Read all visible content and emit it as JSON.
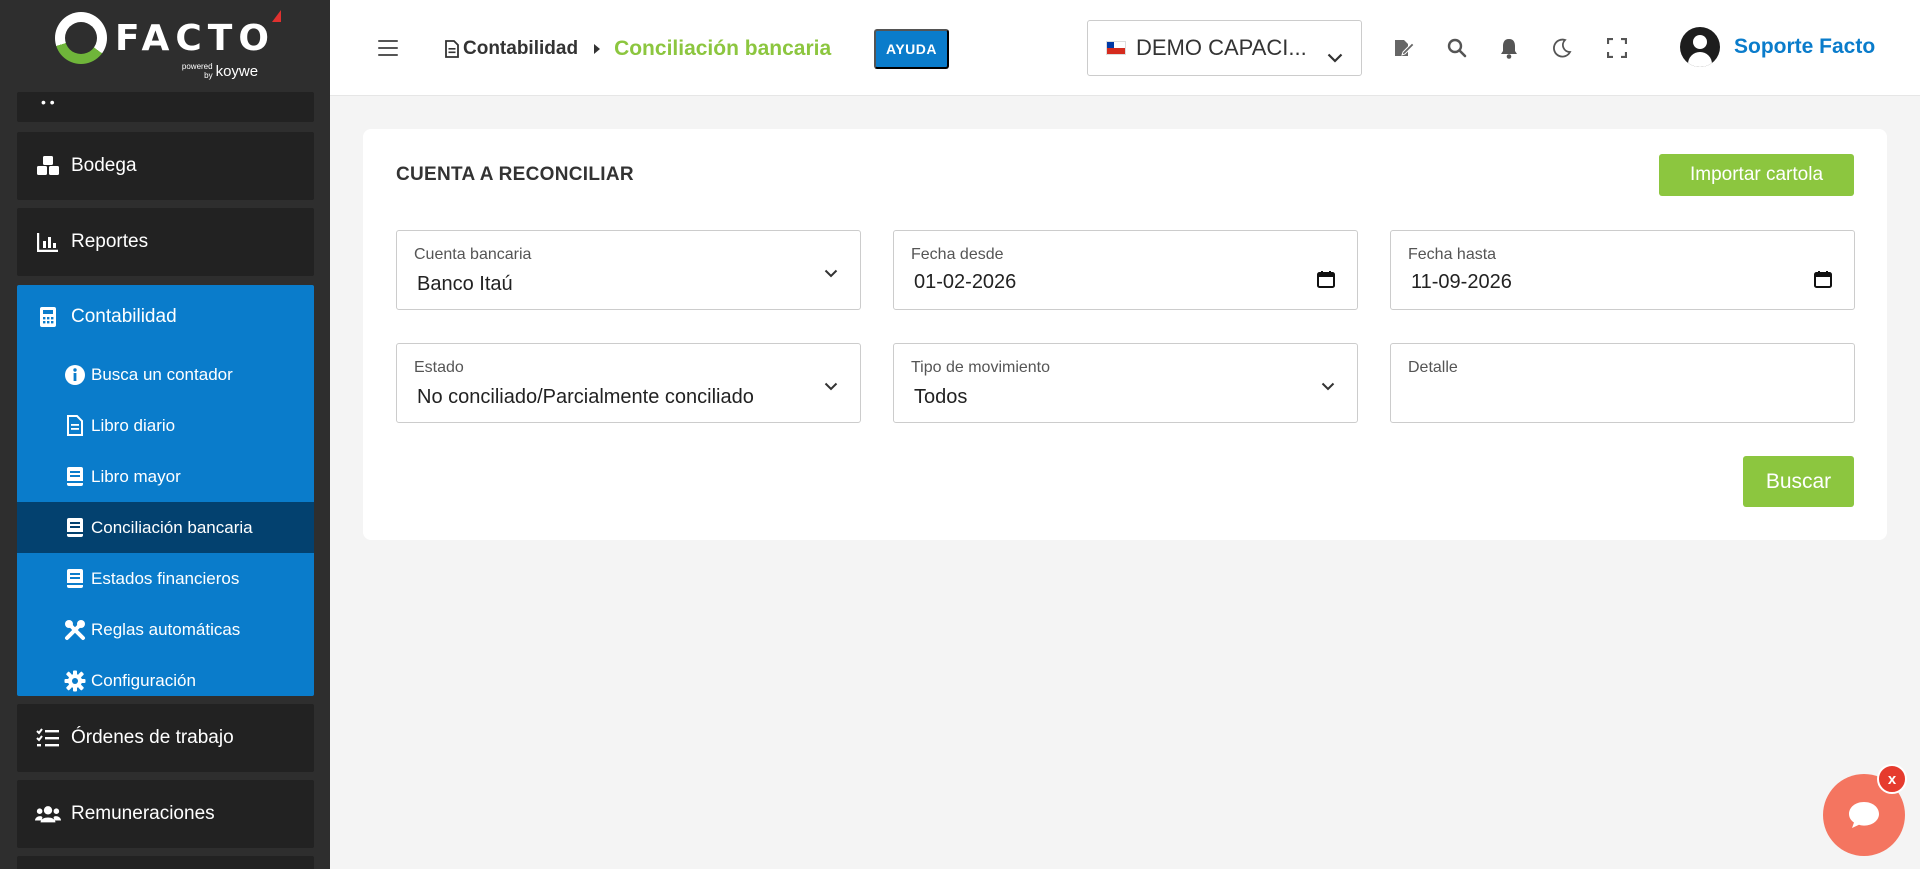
{
  "brand": {
    "name": "FACTO",
    "powered": "powered",
    "by": "by",
    "partner": "koywe"
  },
  "sidebar": {
    "items": [
      {
        "label": "Bodega",
        "icon": "boxes-icon"
      },
      {
        "label": "Reportes",
        "icon": "bar-chart-icon"
      },
      {
        "label": "Contabilidad",
        "icon": "calculator-icon"
      },
      {
        "label": "Órdenes de trabajo",
        "icon": "list-check-icon"
      },
      {
        "label": "Remuneraciones",
        "icon": "users-icon"
      }
    ],
    "contabilidad_sub": [
      {
        "label": "Busca un contador",
        "icon": "info-circle-icon"
      },
      {
        "label": "Libro diario",
        "icon": "file-lines-icon"
      },
      {
        "label": "Libro mayor",
        "icon": "book-icon"
      },
      {
        "label": "Conciliación bancaria",
        "icon": "book-icon"
      },
      {
        "label": "Estados financieros",
        "icon": "book-icon"
      },
      {
        "label": "Reglas automáticas",
        "icon": "tools-icon"
      },
      {
        "label": "Configuración",
        "icon": "gear-icon"
      }
    ]
  },
  "topbar": {
    "breadcrumb_parent": "Contabilidad",
    "breadcrumb_current": "Conciliación bancaria",
    "help_label": "AYUDA",
    "company": "DEMO CAPACI...",
    "user_name": "Soporte Facto"
  },
  "card": {
    "title": "CUENTA A RECONCILIAR",
    "import_label": "Importar cartola",
    "search_label": "Buscar",
    "fields": {
      "cuenta": {
        "label": "Cuenta bancaria",
        "value": "Banco Itaú"
      },
      "desde": {
        "label": "Fecha desde",
        "value": "01-02-2026"
      },
      "hasta": {
        "label": "Fecha hasta",
        "value": "11-09-2026"
      },
      "estado": {
        "label": "Estado",
        "value": "No conciliado/Parcialmente conciliado"
      },
      "tipo": {
        "label": "Tipo de movimiento",
        "value": "Todos"
      },
      "detalle": {
        "label": "Detalle",
        "value": ""
      }
    }
  },
  "chat": {
    "close_label": "x"
  },
  "colors": {
    "accent_blue": "#0a7ccb",
    "accent_green": "#8cc63f",
    "sidebar_bg": "#2e2e2e",
    "active_sub": "#03416f"
  }
}
